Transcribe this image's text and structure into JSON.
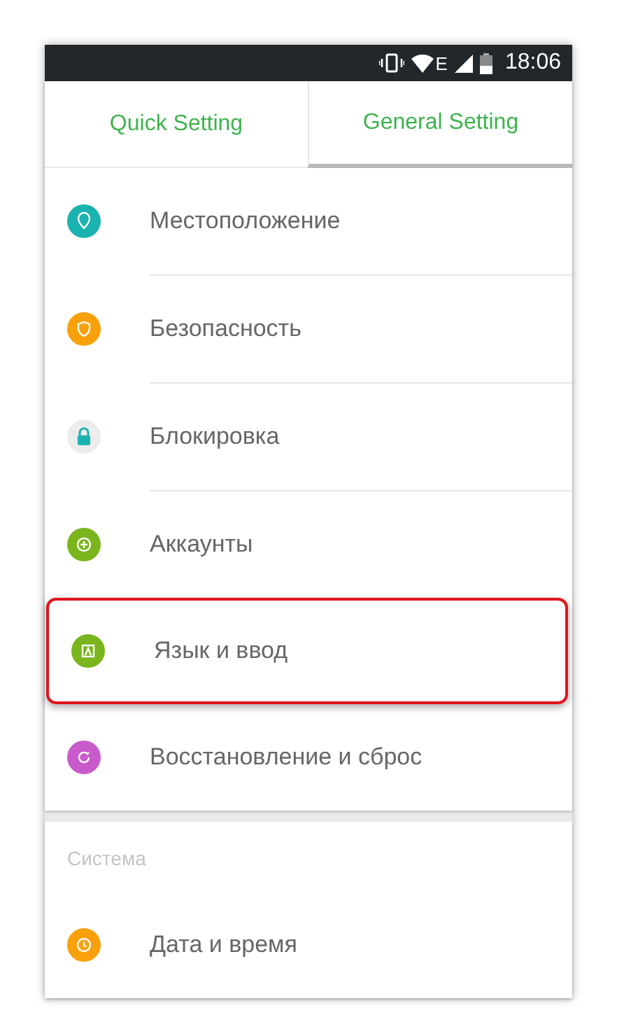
{
  "status_bar": {
    "network": "E",
    "time": "18:06"
  },
  "tabs": [
    {
      "label": "Quick Setting",
      "selected": false
    },
    {
      "label": "General Setting",
      "selected": true
    }
  ],
  "sections": [
    {
      "items": [
        {
          "label": "Местоположение",
          "kind": "location",
          "color": "#1bb3b0",
          "highlighted": false
        },
        {
          "label": "Безопасность",
          "kind": "shield",
          "color": "#f8a10c",
          "highlighted": false
        },
        {
          "label": "Блокировка",
          "kind": "lock",
          "color": "#ececec",
          "highlighted": false
        },
        {
          "label": "Аккаунты",
          "kind": "plus",
          "color": "#7ab51d",
          "highlighted": false
        },
        {
          "label": "Язык и ввод",
          "kind": "language",
          "color": "#7ab51d",
          "highlighted": true
        },
        {
          "label": "Восстановление и сброс",
          "kind": "reset",
          "color": "#c95acb",
          "highlighted": false
        }
      ]
    },
    {
      "title": "Система",
      "items": [
        {
          "label": "Дата и время",
          "kind": "clock",
          "color": "#f8a10c",
          "highlighted": false
        }
      ]
    }
  ]
}
